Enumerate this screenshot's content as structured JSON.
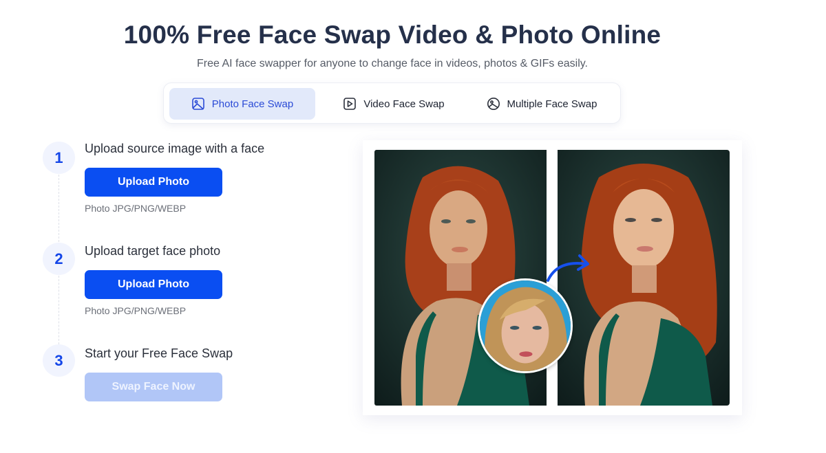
{
  "header": {
    "title": "100% Free Face Swap Video & Photo Online",
    "subtitle": "Free AI face swapper for anyone to change face in videos, photos & GIFs easily."
  },
  "tabs": [
    {
      "label": "Photo Face Swap",
      "icon": "image-icon",
      "active": true
    },
    {
      "label": "Video Face Swap",
      "icon": "play-icon",
      "active": false
    },
    {
      "label": "Multiple Face Swap",
      "icon": "image-circle-icon",
      "active": false
    }
  ],
  "steps": [
    {
      "number": "1",
      "title": "Upload source image with a face",
      "button": "Upload Photo",
      "hint": "Photo JPG/PNG/WEBP"
    },
    {
      "number": "2",
      "title": "Upload target face photo",
      "button": "Upload Photo",
      "hint": "Photo JPG/PNG/WEBP"
    },
    {
      "number": "3",
      "title": "Start your Free Face Swap",
      "button": "Swap Face Now",
      "button_disabled": true
    }
  ],
  "colors": {
    "primary": "#0a4ef2",
    "primary_disabled": "#b1c6f7",
    "tab_active_bg": "#e2e9fa",
    "tab_active_text": "#2b4bd6",
    "step_number": "#1446e8",
    "title": "#25304a"
  },
  "showcase": {
    "images": [
      "original-photo",
      "face-source",
      "swapped-result"
    ]
  }
}
